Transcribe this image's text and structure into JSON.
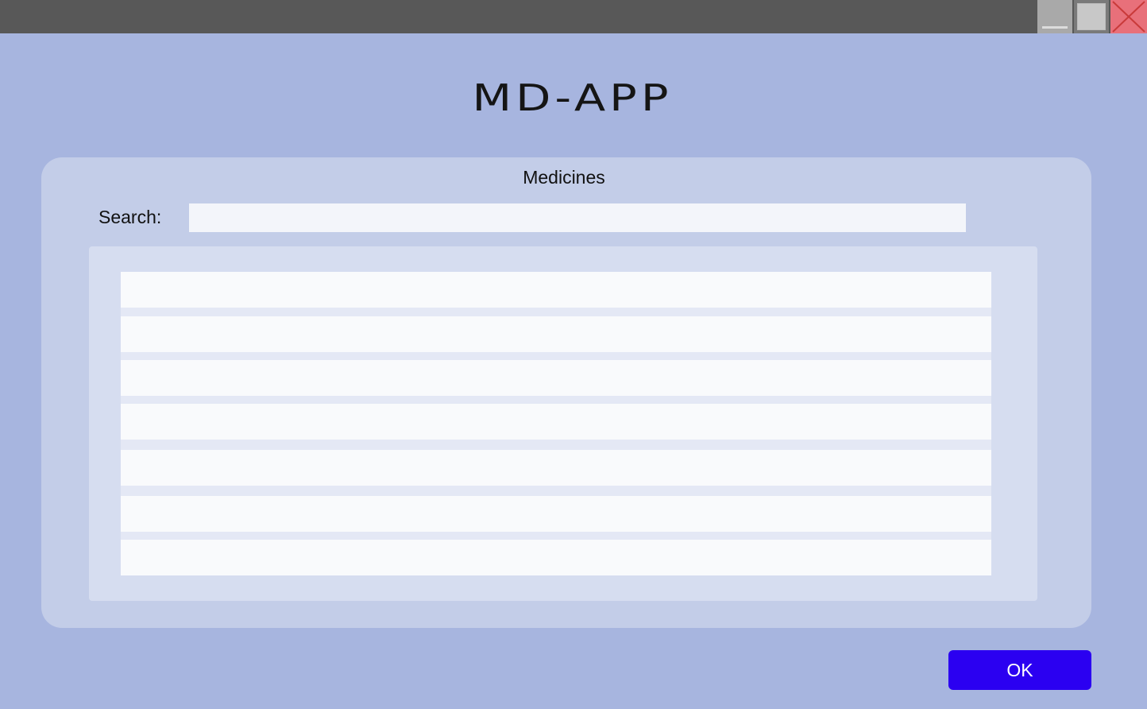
{
  "window": {
    "controls": [
      {
        "name": "minimize",
        "icon": "minimize-icon"
      },
      {
        "name": "maximize",
        "icon": "maximize-icon"
      },
      {
        "name": "close",
        "icon": "close-icon"
      }
    ],
    "close_color": "#e8707a"
  },
  "app": {
    "title": "MD-APP",
    "background": "#a7b5df"
  },
  "panel": {
    "title": "Medicines",
    "search": {
      "label": "Search:",
      "value": "",
      "placeholder": ""
    },
    "list": {
      "rows": [
        "",
        "",
        "",
        "",
        "",
        "",
        ""
      ]
    }
  },
  "footer": {
    "ok_label": "OK",
    "ok_color": "#2b00f1"
  }
}
